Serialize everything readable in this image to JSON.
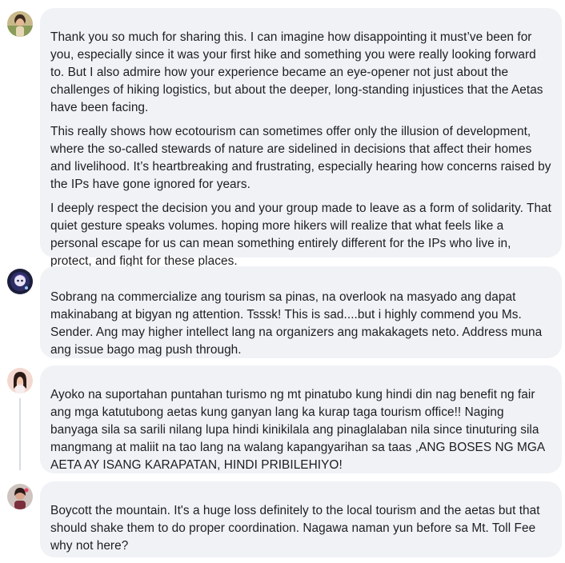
{
  "comments": [
    {
      "paragraphs": [
        "Thank you so much for sharing this. I can imagine how disappointing it must’ve been for you, especially since it was your first hike and something you were really looking forward to. But I also admire how your experience became an eye-opener not just about the challenges of hiking logistics, but about the deeper, long-standing injustices that the Aetas have been facing.",
        "This really shows how ecotourism can sometimes offer only the illusion of development, where the so-called stewards of nature are sidelined in decisions that affect their homes and livelihood. It’s heartbreaking and frustrating, especially hearing how concerns raised by the IPs have gone ignored for years.",
        "I deeply respect the decision you and your group made to leave as a form of solidarity. That quiet gesture speaks volumes. hoping more hikers will realize that what feels like a personal escape for us can mean something entirely different for the IPs who live in, protect, and fight for these places."
      ]
    },
    {
      "paragraphs": [
        "Sobrang na commercialize ang tourism sa pinas, na overlook na masyado ang dapat makinabang at bigyan ng attention. Tsssk! This is sad....but i highly commend you Ms. Sender. Ang may higher intellect lang na organizers ang makakagets neto. Address muna ang issue bago mag push through."
      ]
    },
    {
      "paragraphs": [
        "Ayoko na suportahan puntahan turismo ng mt pinatubo kung hindi din nag benefit ng fair ang mga katutubong aetas kung ganyan lang ka kurap taga tourism office!! Naging banyaga sila sa sarili nilang lupa hindi kinikilala ang pinaglalaban nila since tinuturing sila mangmang at maliit na tao lang na walang kapangyarihan sa taas ,ANG BOSES NG MGA AETA AY ISANG KARAPATAN, HINDI PRIBILEHIYO!"
      ]
    },
    {
      "paragraphs": [
        "Boycott the mountain. It's a huge loss definitely to the local tourism and the aetas but that should shake them to do proper coordination. Nagawa naman yun before sa Mt. Toll Fee why not here?"
      ]
    }
  ]
}
